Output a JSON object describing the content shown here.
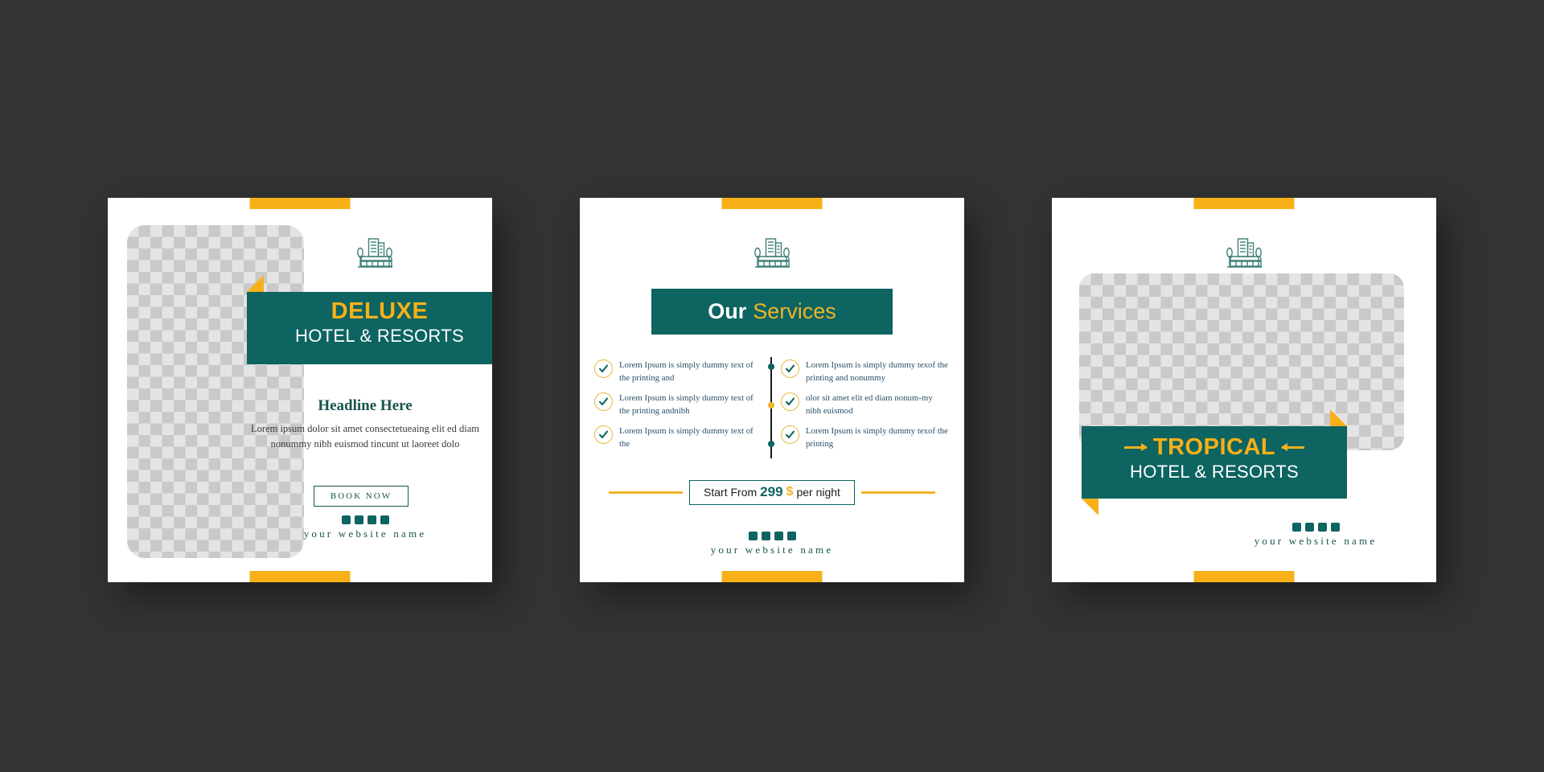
{
  "theme": {
    "background": "#333333",
    "card_background": "#ffffff",
    "teal": "#0d6460",
    "teal_dark": "#17544f",
    "yellow": "#f8b019",
    "yellow_light": "#f0b429",
    "check_ring": "#e8b93e",
    "body_text": "#3a3a3a",
    "service_text": "#29506a"
  },
  "logo": {
    "icon": "hotel-building-icon"
  },
  "cards": [
    {
      "id": "deluxe-card",
      "photo_placeholder": "image-placeholder",
      "brand_main": "DELUXE",
      "brand_sub": "HOTEL & RESORTS",
      "headline": "Headline Here",
      "body": "Lorem ipsum dolor sit amet consectetueaing elit ed diam nonummy nibh euismod tincunt ut laoreet dolo",
      "cta_label": "BOOK NOW",
      "website_name": "your website name",
      "squares": 4
    },
    {
      "id": "services-card",
      "title_part1": "Our",
      "title_part2": "Services",
      "services_left": [
        "Lorem Ipsum is simply dummy text of the printing and",
        "Lorem Ipsum is simply dummy text of the printing andnibh",
        "Lorem Ipsum is simply dummy text of the"
      ],
      "services_right": [
        "Lorem Ipsum is simply dummy texof the printing and nonummy",
        "olor sit amet elit ed diam nonum-my nibh euismod",
        "Lorem Ipsum is simply dummy texof the printing"
      ],
      "price_prefix": "Start From",
      "price_amount": "299",
      "price_currency": "$",
      "price_suffix": "per night",
      "website_name": "your website name",
      "squares": 4
    },
    {
      "id": "tropical-card",
      "photo_placeholder": "image-placeholder",
      "brand_main": "TROPICAL",
      "brand_sub": "HOTEL & RESORTS",
      "website_name": "your website name",
      "squares": 4
    }
  ]
}
